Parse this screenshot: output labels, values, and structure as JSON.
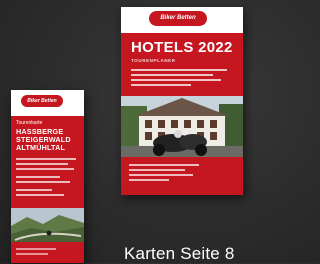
{
  "hotel_brochure": {
    "logo": "Biker Betten",
    "title": "HOTELS 2022",
    "subtitle": "TOURENPLANER"
  },
  "map_brochure": {
    "logo": "Biker Betten",
    "kicker": "Tourenkarte",
    "region_lines": [
      "HASSBERGE",
      "STEIGERWALD",
      "ALTMÜHLTAL"
    ]
  },
  "caption": "Karten Seite 8"
}
